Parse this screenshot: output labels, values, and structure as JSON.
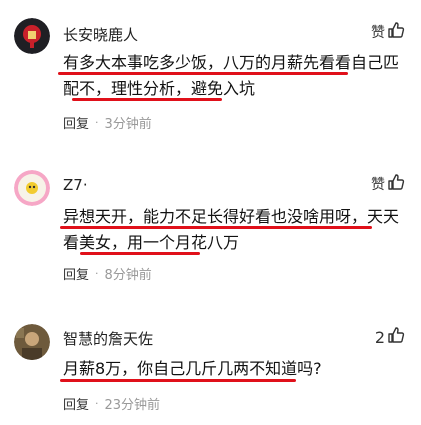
{
  "comments": [
    {
      "username": "长安晓鹿人",
      "like_label": "赞",
      "lines": [
        "有多大本事吃多少饭，八万的月薪先看看自己匹",
        "配不，理性分析，避免入坑"
      ],
      "reply_label": "回复",
      "time": "3分钟前"
    },
    {
      "username": "Z7·",
      "like_label": "赞",
      "lines": [
        "异想天开，能力不足长得好看也没啥用呀，天天",
        "看美女，用一个月花八万"
      ],
      "reply_label": "回复",
      "time": "8分钟前"
    },
    {
      "username": "智慧的詹天佐",
      "like_label": "2",
      "lines": [
        "月薪8万，你自己几斤几两不知道吗?"
      ],
      "reply_label": "回复",
      "time": "23分钟前"
    }
  ],
  "colors": {
    "underline": "#e0101a",
    "meta_gray": "#999999"
  },
  "icons": {
    "like": "thumbs-up-icon"
  }
}
